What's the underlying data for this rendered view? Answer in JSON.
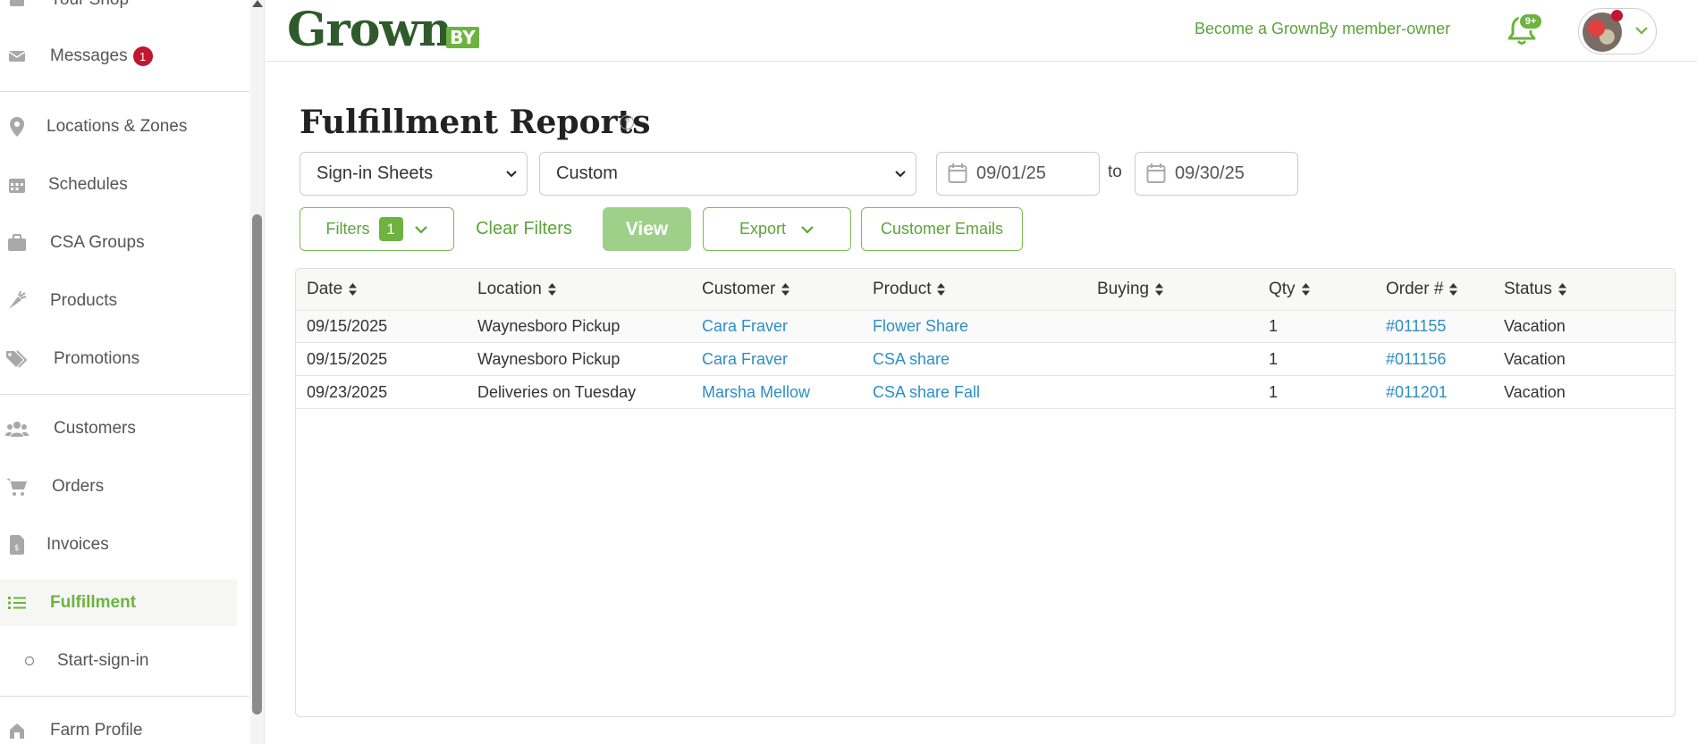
{
  "sidebar": {
    "top_partial_label": "Your Shop",
    "items": [
      {
        "label": "Messages",
        "badge": "1"
      },
      {
        "label": "Locations & Zones"
      },
      {
        "label": "Schedules"
      },
      {
        "label": "CSA Groups"
      },
      {
        "label": "Products"
      },
      {
        "label": "Promotions"
      },
      {
        "label": "Customers"
      },
      {
        "label": "Orders"
      },
      {
        "label": "Invoices"
      },
      {
        "label": "Fulfillment"
      },
      {
        "label": "Start-sign-in"
      },
      {
        "label": "Farm Profile"
      }
    ]
  },
  "header": {
    "logo_main": "Grown",
    "logo_by": "BY",
    "member_link": "Become a GrownBy member-owner",
    "notification_count": "9+"
  },
  "page": {
    "title": "Fulfillment Reports",
    "help": "?"
  },
  "controls": {
    "report_type": "Sign-in Sheets",
    "range_type": "Custom",
    "date_from": "09/01/25",
    "date_to": "09/30/25",
    "to_label": "to",
    "filters_label": "Filters",
    "filters_count": "1",
    "clear_filters": "Clear Filters",
    "view": "View",
    "export": "Export",
    "customer_emails": "Customer Emails"
  },
  "table": {
    "columns": [
      "Date",
      "Location",
      "Customer",
      "Product",
      "Buying",
      "Qty",
      "Order #",
      "Status"
    ],
    "rows": [
      {
        "date": "09/15/2025",
        "location": "Waynesboro Pickup",
        "customer": "Cara Fraver",
        "product": "Flower Share",
        "buying": "",
        "qty": "1",
        "order": "#011155",
        "status": "Vacation"
      },
      {
        "date": "09/15/2025",
        "location": "Waynesboro Pickup",
        "customer": "Cara Fraver",
        "product": "CSA share",
        "buying": "",
        "qty": "1",
        "order": "#011156",
        "status": "Vacation"
      },
      {
        "date": "09/23/2025",
        "location": "Deliveries on Tuesday",
        "customer": "Marsha Mellow",
        "product": "CSA share Fall",
        "buying": "",
        "qty": "1",
        "order": "#011201",
        "status": "Vacation"
      }
    ]
  },
  "colors": {
    "brand_green": "#6cb33f",
    "logo_dark_green": "#2f5a2b",
    "link_blue": "#2d8fc4",
    "badge_red": "#c0172f"
  }
}
